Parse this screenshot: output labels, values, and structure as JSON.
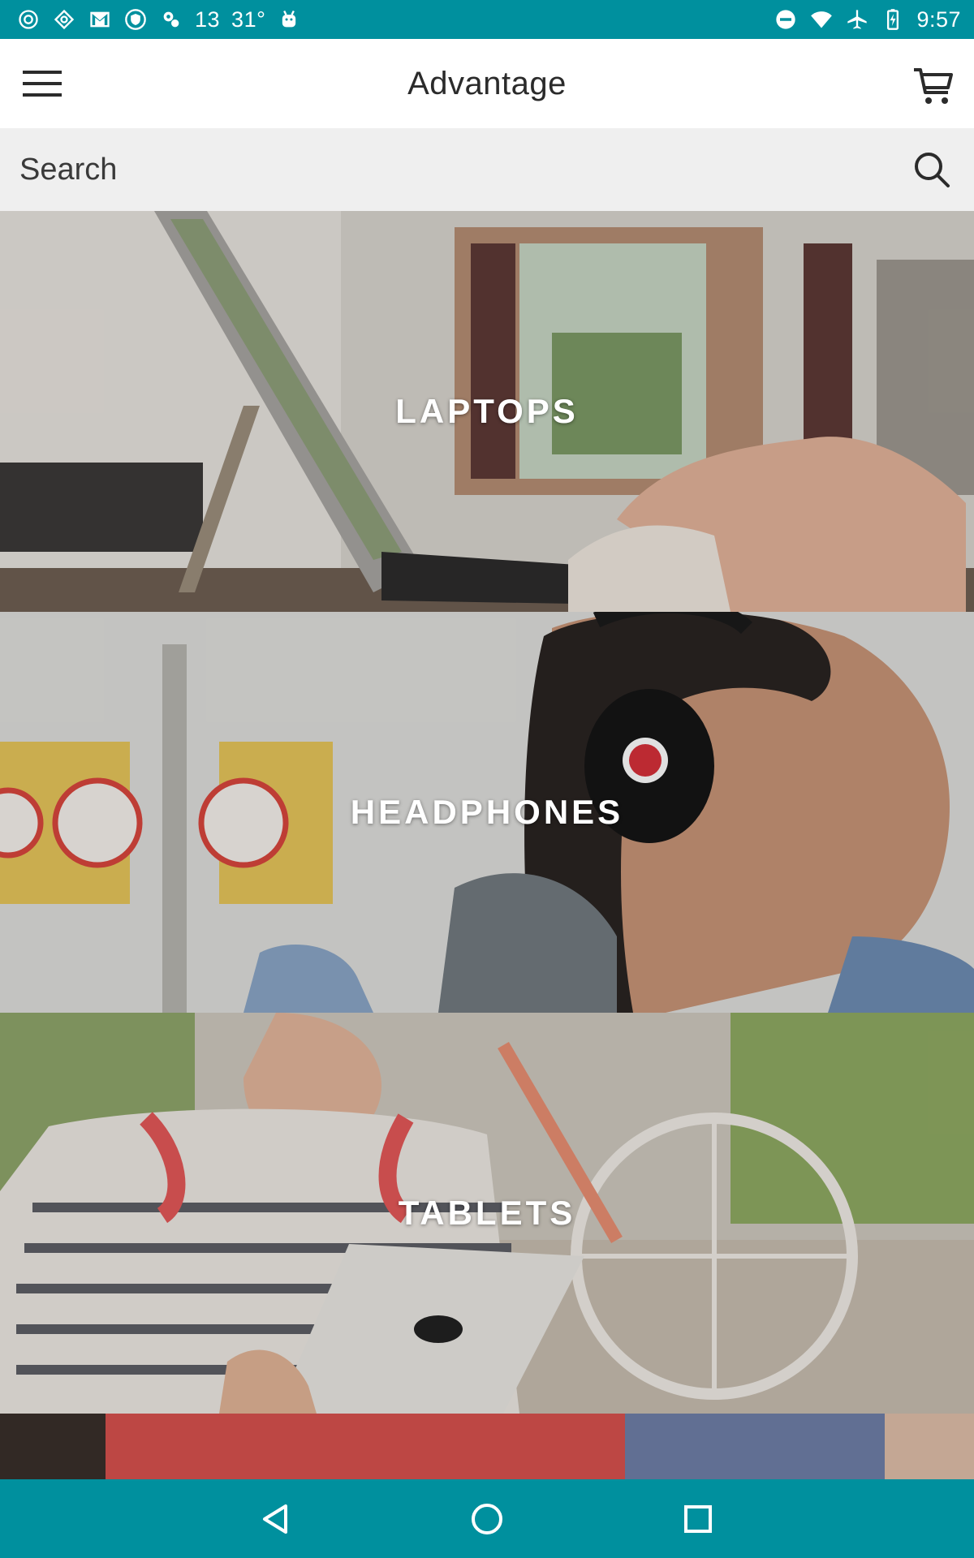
{
  "status_bar": {
    "notification_count": "13",
    "temperature": "31°",
    "time": "9:57",
    "left_icons": [
      "settings-gear-icon",
      "tag-icon",
      "gmail-icon",
      "shield-icon",
      "puzzle-icon",
      "android-icon"
    ],
    "right_icons": [
      "do-not-disturb-icon",
      "wifi-icon",
      "airplane-mode-icon",
      "battery-charging-icon"
    ]
  },
  "app_bar": {
    "title": "Advantage"
  },
  "search": {
    "placeholder": "Search"
  },
  "categories": [
    {
      "label": "LAPTOPS"
    },
    {
      "label": "HEADPHONES"
    },
    {
      "label": "TABLETS"
    },
    {
      "label": ""
    }
  ],
  "colors": {
    "system_bar": "#00909e",
    "app_bar_bg": "#ffffff",
    "search_bg": "#efefef",
    "title_text": "#2b2b2b"
  }
}
